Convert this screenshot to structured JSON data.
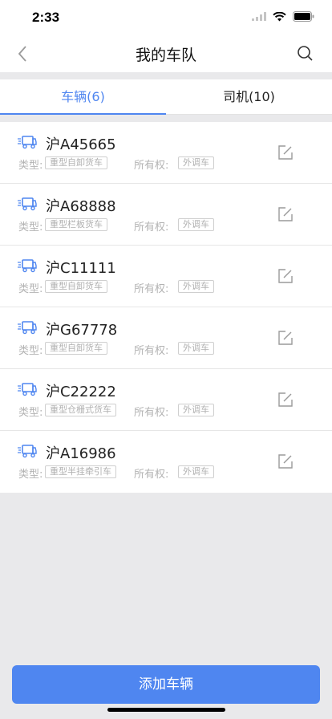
{
  "status": {
    "time": "2:33"
  },
  "header": {
    "title": "我的车队"
  },
  "tabs": [
    {
      "label": "车辆(6)",
      "active": true
    },
    {
      "label": "司机(10)",
      "active": false
    }
  ],
  "labels": {
    "type": "类型:",
    "ownership": "所有权:"
  },
  "vehicles": [
    {
      "plate": "沪A45665",
      "type": "重型自卸货车",
      "ownership": "外调车"
    },
    {
      "plate": "沪A68888",
      "type": "重型栏板货车",
      "ownership": "外调车"
    },
    {
      "plate": "沪C11111",
      "type": "重型自卸货车",
      "ownership": "外调车"
    },
    {
      "plate": "沪G67778",
      "type": "重型自卸货车",
      "ownership": "外调车"
    },
    {
      "plate": "沪C22222",
      "type": "重型仓栅式货车",
      "ownership": "外调车"
    },
    {
      "plate": "沪A16986",
      "type": "重型半挂牵引车",
      "ownership": "外调车"
    }
  ],
  "footer": {
    "add_label": "添加车辆"
  },
  "colors": {
    "accent": "#4f86f0"
  }
}
